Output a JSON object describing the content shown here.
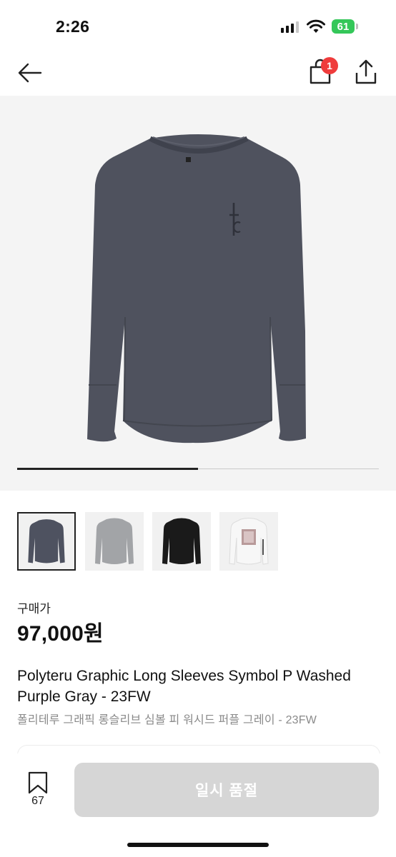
{
  "status_bar": {
    "time": "2:26",
    "battery": "61"
  },
  "nav": {
    "cart_count": "1"
  },
  "gallery": {
    "progress": 0.5,
    "thumbnails": [
      {
        "name": "washed-purple-gray",
        "color": "#4e5260",
        "selected": true
      },
      {
        "name": "gray",
        "color": "#a2a4a7",
        "selected": false
      },
      {
        "name": "black",
        "color": "#1a1a1a",
        "selected": false
      },
      {
        "name": "white-graphic",
        "color": "#eeeeee",
        "selected": false
      }
    ]
  },
  "product": {
    "price_label": "구매가",
    "price": "97,000원",
    "title_en": "Polyteru Graphic Long Sleeves Symbol P Washed Purple Gray - 23FW",
    "title_ko": "폴리테루 그래픽 롱슬리브 심볼 피 워시드 퍼플 그레이 - 23FW"
  },
  "bottom_bar": {
    "bookmark_count": "67",
    "action_label": "일시 품절"
  },
  "colors": {
    "shirt": "#4f525e",
    "button_disabled": "#d6d6d6",
    "badge": "#ef3c3c",
    "battery": "#34c759"
  }
}
